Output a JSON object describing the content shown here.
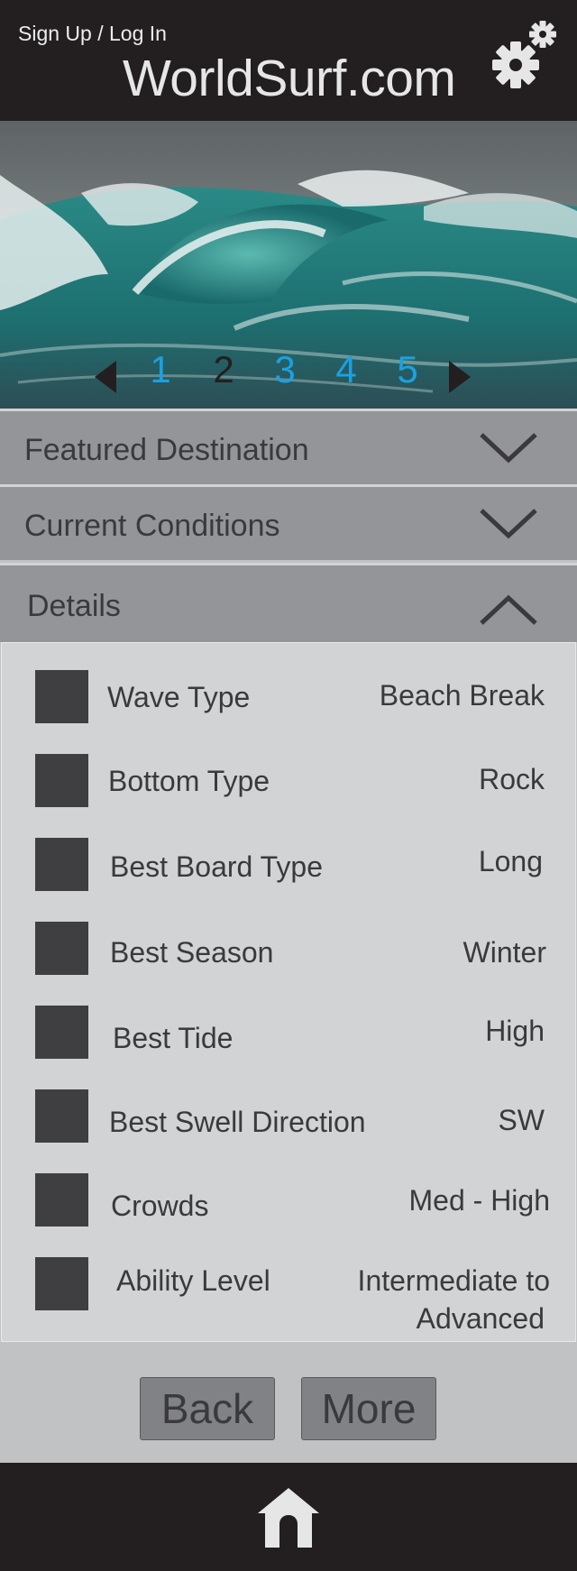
{
  "header": {
    "auth_link": "Sign Up / Log In",
    "brand": "WorldSurf.com",
    "settings_icon": "gear-icon"
  },
  "carousel": {
    "pages": [
      "1",
      "2",
      "3",
      "4",
      "5"
    ],
    "current_page": "2",
    "prev_icon": "triangle-left-icon",
    "next_icon": "triangle-right-icon"
  },
  "sections": {
    "featured": {
      "label": "Featured Destination",
      "state": "collapsed"
    },
    "conditions": {
      "label": "Current Conditions",
      "state": "collapsed"
    },
    "details": {
      "label": "Details",
      "state": "expanded"
    }
  },
  "details": {
    "rows": [
      {
        "label": "Wave Type",
        "value": "Beach Break"
      },
      {
        "label": "Bottom Type",
        "value": "Rock"
      },
      {
        "label": "Best Board Type",
        "value": "Long"
      },
      {
        "label": "Best Season",
        "value": "Winter"
      },
      {
        "label": "Best Tide",
        "value": "High"
      },
      {
        "label": "Best Swell Direction",
        "value": "SW"
      },
      {
        "label": "Crowds",
        "value": "Med - High"
      },
      {
        "label": "Ability Level",
        "value": "Intermediate to",
        "value2": "Advanced"
      }
    ]
  },
  "actions": {
    "back": "Back",
    "more": "More"
  },
  "footer": {
    "home_icon": "home-icon"
  },
  "colors": {
    "header_bg": "#231f20",
    "section_bar": "#939598",
    "panel_bg": "#d1d3d4",
    "page_link": "#1ba1e2",
    "checkbox": "#3f3f42"
  }
}
